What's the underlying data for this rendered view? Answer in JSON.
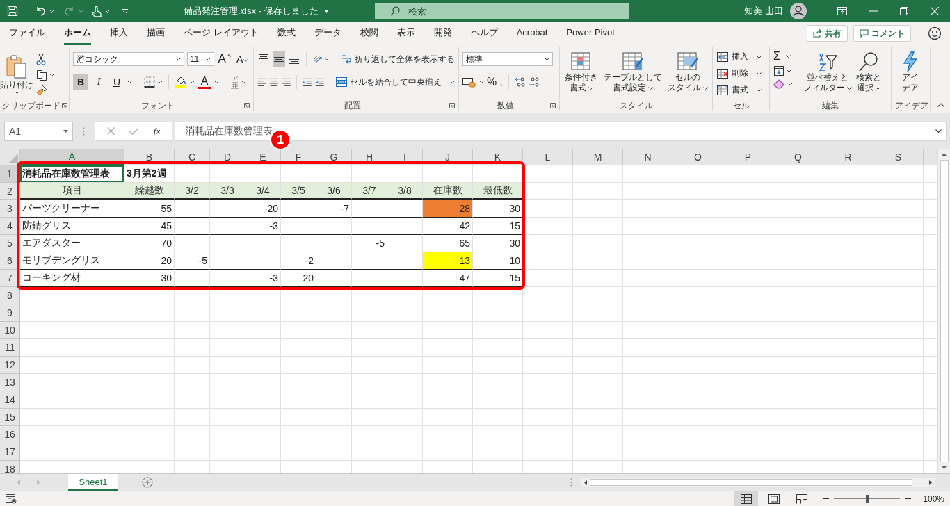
{
  "title_bar": {
    "file_title": "備品発注管理.xlsx - 保存しました",
    "search_placeholder": "検索",
    "user_name": "知美 山田"
  },
  "menu_tabs": [
    {
      "label": "ファイル",
      "selected": false
    },
    {
      "label": "ホーム",
      "selected": true
    },
    {
      "label": "挿入",
      "selected": false
    },
    {
      "label": "描画",
      "selected": false
    },
    {
      "label": "ページ レイアウト",
      "selected": false
    },
    {
      "label": "数式",
      "selected": false
    },
    {
      "label": "データ",
      "selected": false
    },
    {
      "label": "校閲",
      "selected": false
    },
    {
      "label": "表示",
      "selected": false
    },
    {
      "label": "開発",
      "selected": false
    },
    {
      "label": "ヘルプ",
      "selected": false
    },
    {
      "label": "Acrobat",
      "selected": false
    },
    {
      "label": "Power Pivot",
      "selected": false
    }
  ],
  "share_button": "共有",
  "comment_button": "コメント",
  "ribbon": {
    "clipboard": {
      "paste": "貼り付け",
      "group_label": "クリップボード"
    },
    "font": {
      "font_name": "游ゴシック",
      "font_size": "11",
      "grow_glyph": "A",
      "shrink_glyph": "A",
      "style_buttons": [
        {
          "glyph": "B",
          "selected": true
        },
        {
          "glyph": "I",
          "selected": false
        },
        {
          "glyph": "U",
          "selected": false
        }
      ],
      "font_color_glyph": "A",
      "ruby_glyphs": [
        "ア",
        "亜"
      ],
      "group_label": "フォント"
    },
    "alignment": {
      "vertical_align": [
        {
          "selected": false
        },
        {
          "selected": true
        },
        {
          "selected": false
        }
      ],
      "wrap": "折り返して全体を表示する",
      "merge": "セルを結合して中央揃え",
      "group_label": "配置"
    },
    "number": {
      "format": "標準",
      "percent": "%",
      "comma": ",",
      "group_label": "数値"
    },
    "styles": {
      "buttons": [
        {
          "lines": [
            "条件付き",
            "書式"
          ]
        },
        {
          "lines": [
            "テーブルとして",
            "書式設定"
          ]
        },
        {
          "lines": [
            "セルの",
            "スタイル"
          ]
        }
      ],
      "group_label": "スタイル"
    },
    "cells": {
      "buttons": [
        "挿入",
        "削除",
        "書式"
      ],
      "group_label": "セル"
    },
    "editing": {
      "sum_glyph": "Σ",
      "buttons": [
        {
          "lines": [
            "並べ替えと",
            "フィルター"
          ]
        },
        {
          "lines": [
            "検索と",
            "選択"
          ]
        }
      ],
      "group_label": "編集"
    },
    "ideas": {
      "lines": [
        "アイ",
        "デア"
      ],
      "group_label": "アイデア"
    }
  },
  "formula_bar": {
    "name_box": "A1",
    "fx": "fx",
    "formula": "消耗品在庫数管理表"
  },
  "callout_number": "1",
  "sheet": {
    "columns": [
      "A",
      "B",
      "C",
      "D",
      "E",
      "F",
      "G",
      "H",
      "I",
      "J",
      "K",
      "L",
      "M",
      "N",
      "O",
      "P",
      "Q",
      "R",
      "S"
    ],
    "row_numbers": [
      "1",
      "2",
      "3",
      "4",
      "5",
      "6",
      "7",
      "8",
      "9",
      "10",
      "11",
      "12",
      "13",
      "14",
      "15",
      "16",
      "17",
      "18"
    ],
    "rows": [
      {
        "kind": "title",
        "cells": [
          {
            "text": "消耗品在庫数管理表",
            "selected": true
          },
          "3月第2週",
          null,
          null,
          null,
          null,
          null,
          null,
          null,
          null,
          null
        ]
      },
      {
        "kind": "header",
        "cells": [
          "項目",
          "繰越数",
          "3/2",
          "3/3",
          "3/4",
          "3/5",
          "3/6",
          "3/7",
          "3/8",
          "在庫数",
          "最低数"
        ]
      },
      {
        "kind": "data",
        "cells": [
          "パーツクリーナー",
          "55",
          null,
          null,
          "-20",
          null,
          "-7",
          null,
          null,
          {
            "text": "28",
            "color": "#ed7d31"
          },
          "30"
        ]
      },
      {
        "kind": "data",
        "cells": [
          "防錆グリス",
          "45",
          null,
          null,
          "-3",
          null,
          null,
          null,
          null,
          "42",
          "15"
        ]
      },
      {
        "kind": "data",
        "cells": [
          "エアダスター",
          "70",
          null,
          null,
          null,
          null,
          null,
          "-5",
          null,
          "65",
          "30"
        ]
      },
      {
        "kind": "data",
        "cells": [
          "モリブデングリス",
          "20",
          "-5",
          null,
          null,
          "-2",
          null,
          null,
          null,
          {
            "text": "13",
            "color": "#ffff00"
          },
          "10"
        ]
      },
      {
        "kind": "data",
        "cells": [
          "コーキング材",
          "30",
          null,
          null,
          "-3",
          "20",
          null,
          null,
          null,
          "47",
          "15"
        ]
      }
    ]
  },
  "sheet_tabs": [
    {
      "label": "Sheet1",
      "selected": true
    }
  ],
  "status_bar": {
    "zoom": {
      "level": 0.5
    },
    "zoom_label": "100%"
  }
}
